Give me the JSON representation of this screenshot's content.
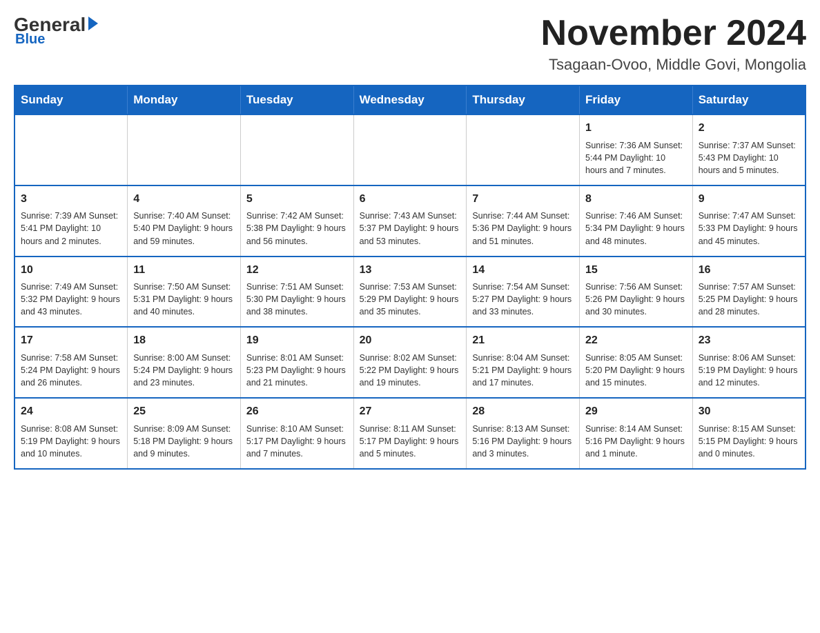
{
  "logo": {
    "general": "General",
    "triangle": "",
    "blue": "Blue"
  },
  "header": {
    "month_title": "November 2024",
    "location": "Tsagaan-Ovoo, Middle Govi, Mongolia"
  },
  "weekdays": [
    "Sunday",
    "Monday",
    "Tuesday",
    "Wednesday",
    "Thursday",
    "Friday",
    "Saturday"
  ],
  "weeks": [
    [
      {
        "day": "",
        "info": ""
      },
      {
        "day": "",
        "info": ""
      },
      {
        "day": "",
        "info": ""
      },
      {
        "day": "",
        "info": ""
      },
      {
        "day": "",
        "info": ""
      },
      {
        "day": "1",
        "info": "Sunrise: 7:36 AM\nSunset: 5:44 PM\nDaylight: 10 hours and 7 minutes."
      },
      {
        "day": "2",
        "info": "Sunrise: 7:37 AM\nSunset: 5:43 PM\nDaylight: 10 hours and 5 minutes."
      }
    ],
    [
      {
        "day": "3",
        "info": "Sunrise: 7:39 AM\nSunset: 5:41 PM\nDaylight: 10 hours and 2 minutes."
      },
      {
        "day": "4",
        "info": "Sunrise: 7:40 AM\nSunset: 5:40 PM\nDaylight: 9 hours and 59 minutes."
      },
      {
        "day": "5",
        "info": "Sunrise: 7:42 AM\nSunset: 5:38 PM\nDaylight: 9 hours and 56 minutes."
      },
      {
        "day": "6",
        "info": "Sunrise: 7:43 AM\nSunset: 5:37 PM\nDaylight: 9 hours and 53 minutes."
      },
      {
        "day": "7",
        "info": "Sunrise: 7:44 AM\nSunset: 5:36 PM\nDaylight: 9 hours and 51 minutes."
      },
      {
        "day": "8",
        "info": "Sunrise: 7:46 AM\nSunset: 5:34 PM\nDaylight: 9 hours and 48 minutes."
      },
      {
        "day": "9",
        "info": "Sunrise: 7:47 AM\nSunset: 5:33 PM\nDaylight: 9 hours and 45 minutes."
      }
    ],
    [
      {
        "day": "10",
        "info": "Sunrise: 7:49 AM\nSunset: 5:32 PM\nDaylight: 9 hours and 43 minutes."
      },
      {
        "day": "11",
        "info": "Sunrise: 7:50 AM\nSunset: 5:31 PM\nDaylight: 9 hours and 40 minutes."
      },
      {
        "day": "12",
        "info": "Sunrise: 7:51 AM\nSunset: 5:30 PM\nDaylight: 9 hours and 38 minutes."
      },
      {
        "day": "13",
        "info": "Sunrise: 7:53 AM\nSunset: 5:29 PM\nDaylight: 9 hours and 35 minutes."
      },
      {
        "day": "14",
        "info": "Sunrise: 7:54 AM\nSunset: 5:27 PM\nDaylight: 9 hours and 33 minutes."
      },
      {
        "day": "15",
        "info": "Sunrise: 7:56 AM\nSunset: 5:26 PM\nDaylight: 9 hours and 30 minutes."
      },
      {
        "day": "16",
        "info": "Sunrise: 7:57 AM\nSunset: 5:25 PM\nDaylight: 9 hours and 28 minutes."
      }
    ],
    [
      {
        "day": "17",
        "info": "Sunrise: 7:58 AM\nSunset: 5:24 PM\nDaylight: 9 hours and 26 minutes."
      },
      {
        "day": "18",
        "info": "Sunrise: 8:00 AM\nSunset: 5:24 PM\nDaylight: 9 hours and 23 minutes."
      },
      {
        "day": "19",
        "info": "Sunrise: 8:01 AM\nSunset: 5:23 PM\nDaylight: 9 hours and 21 minutes."
      },
      {
        "day": "20",
        "info": "Sunrise: 8:02 AM\nSunset: 5:22 PM\nDaylight: 9 hours and 19 minutes."
      },
      {
        "day": "21",
        "info": "Sunrise: 8:04 AM\nSunset: 5:21 PM\nDaylight: 9 hours and 17 minutes."
      },
      {
        "day": "22",
        "info": "Sunrise: 8:05 AM\nSunset: 5:20 PM\nDaylight: 9 hours and 15 minutes."
      },
      {
        "day": "23",
        "info": "Sunrise: 8:06 AM\nSunset: 5:19 PM\nDaylight: 9 hours and 12 minutes."
      }
    ],
    [
      {
        "day": "24",
        "info": "Sunrise: 8:08 AM\nSunset: 5:19 PM\nDaylight: 9 hours and 10 minutes."
      },
      {
        "day": "25",
        "info": "Sunrise: 8:09 AM\nSunset: 5:18 PM\nDaylight: 9 hours and 9 minutes."
      },
      {
        "day": "26",
        "info": "Sunrise: 8:10 AM\nSunset: 5:17 PM\nDaylight: 9 hours and 7 minutes."
      },
      {
        "day": "27",
        "info": "Sunrise: 8:11 AM\nSunset: 5:17 PM\nDaylight: 9 hours and 5 minutes."
      },
      {
        "day": "28",
        "info": "Sunrise: 8:13 AM\nSunset: 5:16 PM\nDaylight: 9 hours and 3 minutes."
      },
      {
        "day": "29",
        "info": "Sunrise: 8:14 AM\nSunset: 5:16 PM\nDaylight: 9 hours and 1 minute."
      },
      {
        "day": "30",
        "info": "Sunrise: 8:15 AM\nSunset: 5:15 PM\nDaylight: 9 hours and 0 minutes."
      }
    ]
  ]
}
